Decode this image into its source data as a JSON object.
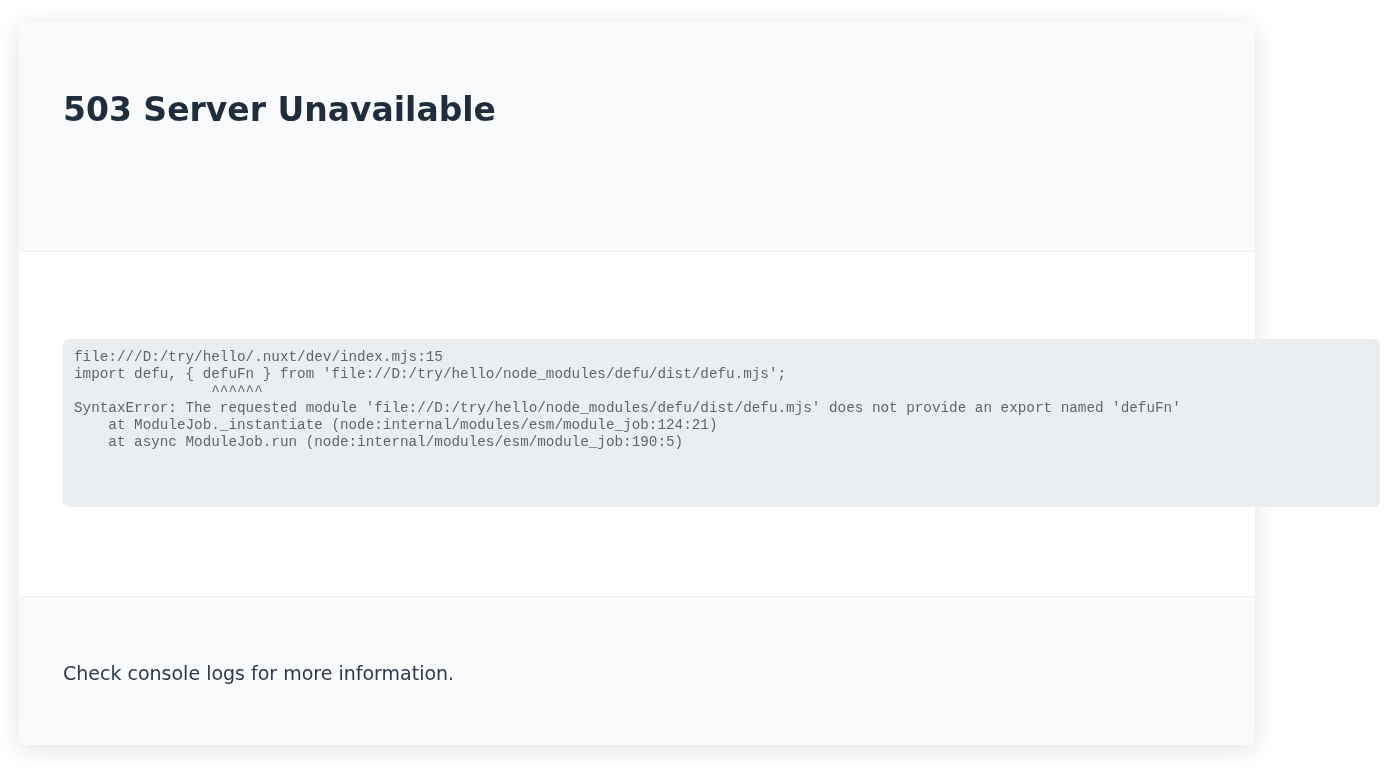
{
  "header": {
    "title": "503 Server Unavailable"
  },
  "body": {
    "code_lines": [
      "file:///D:/try/hello/.nuxt/dev/index.mjs:15",
      "import defu, { defuFn } from 'file://D:/try/hello/node_modules/defu/dist/defu.mjs';",
      "                ^^^^^^",
      "SyntaxError: The requested module 'file://D:/try/hello/node_modules/defu/dist/defu.mjs' does not provide an export named 'defuFn'",
      "    at ModuleJob._instantiate (node:internal/modules/esm/module_job:124:21)",
      "    at async ModuleJob.run (node:internal/modules/esm/module_job:190:5)"
    ]
  },
  "footer": {
    "text": "Check console logs for more information."
  }
}
